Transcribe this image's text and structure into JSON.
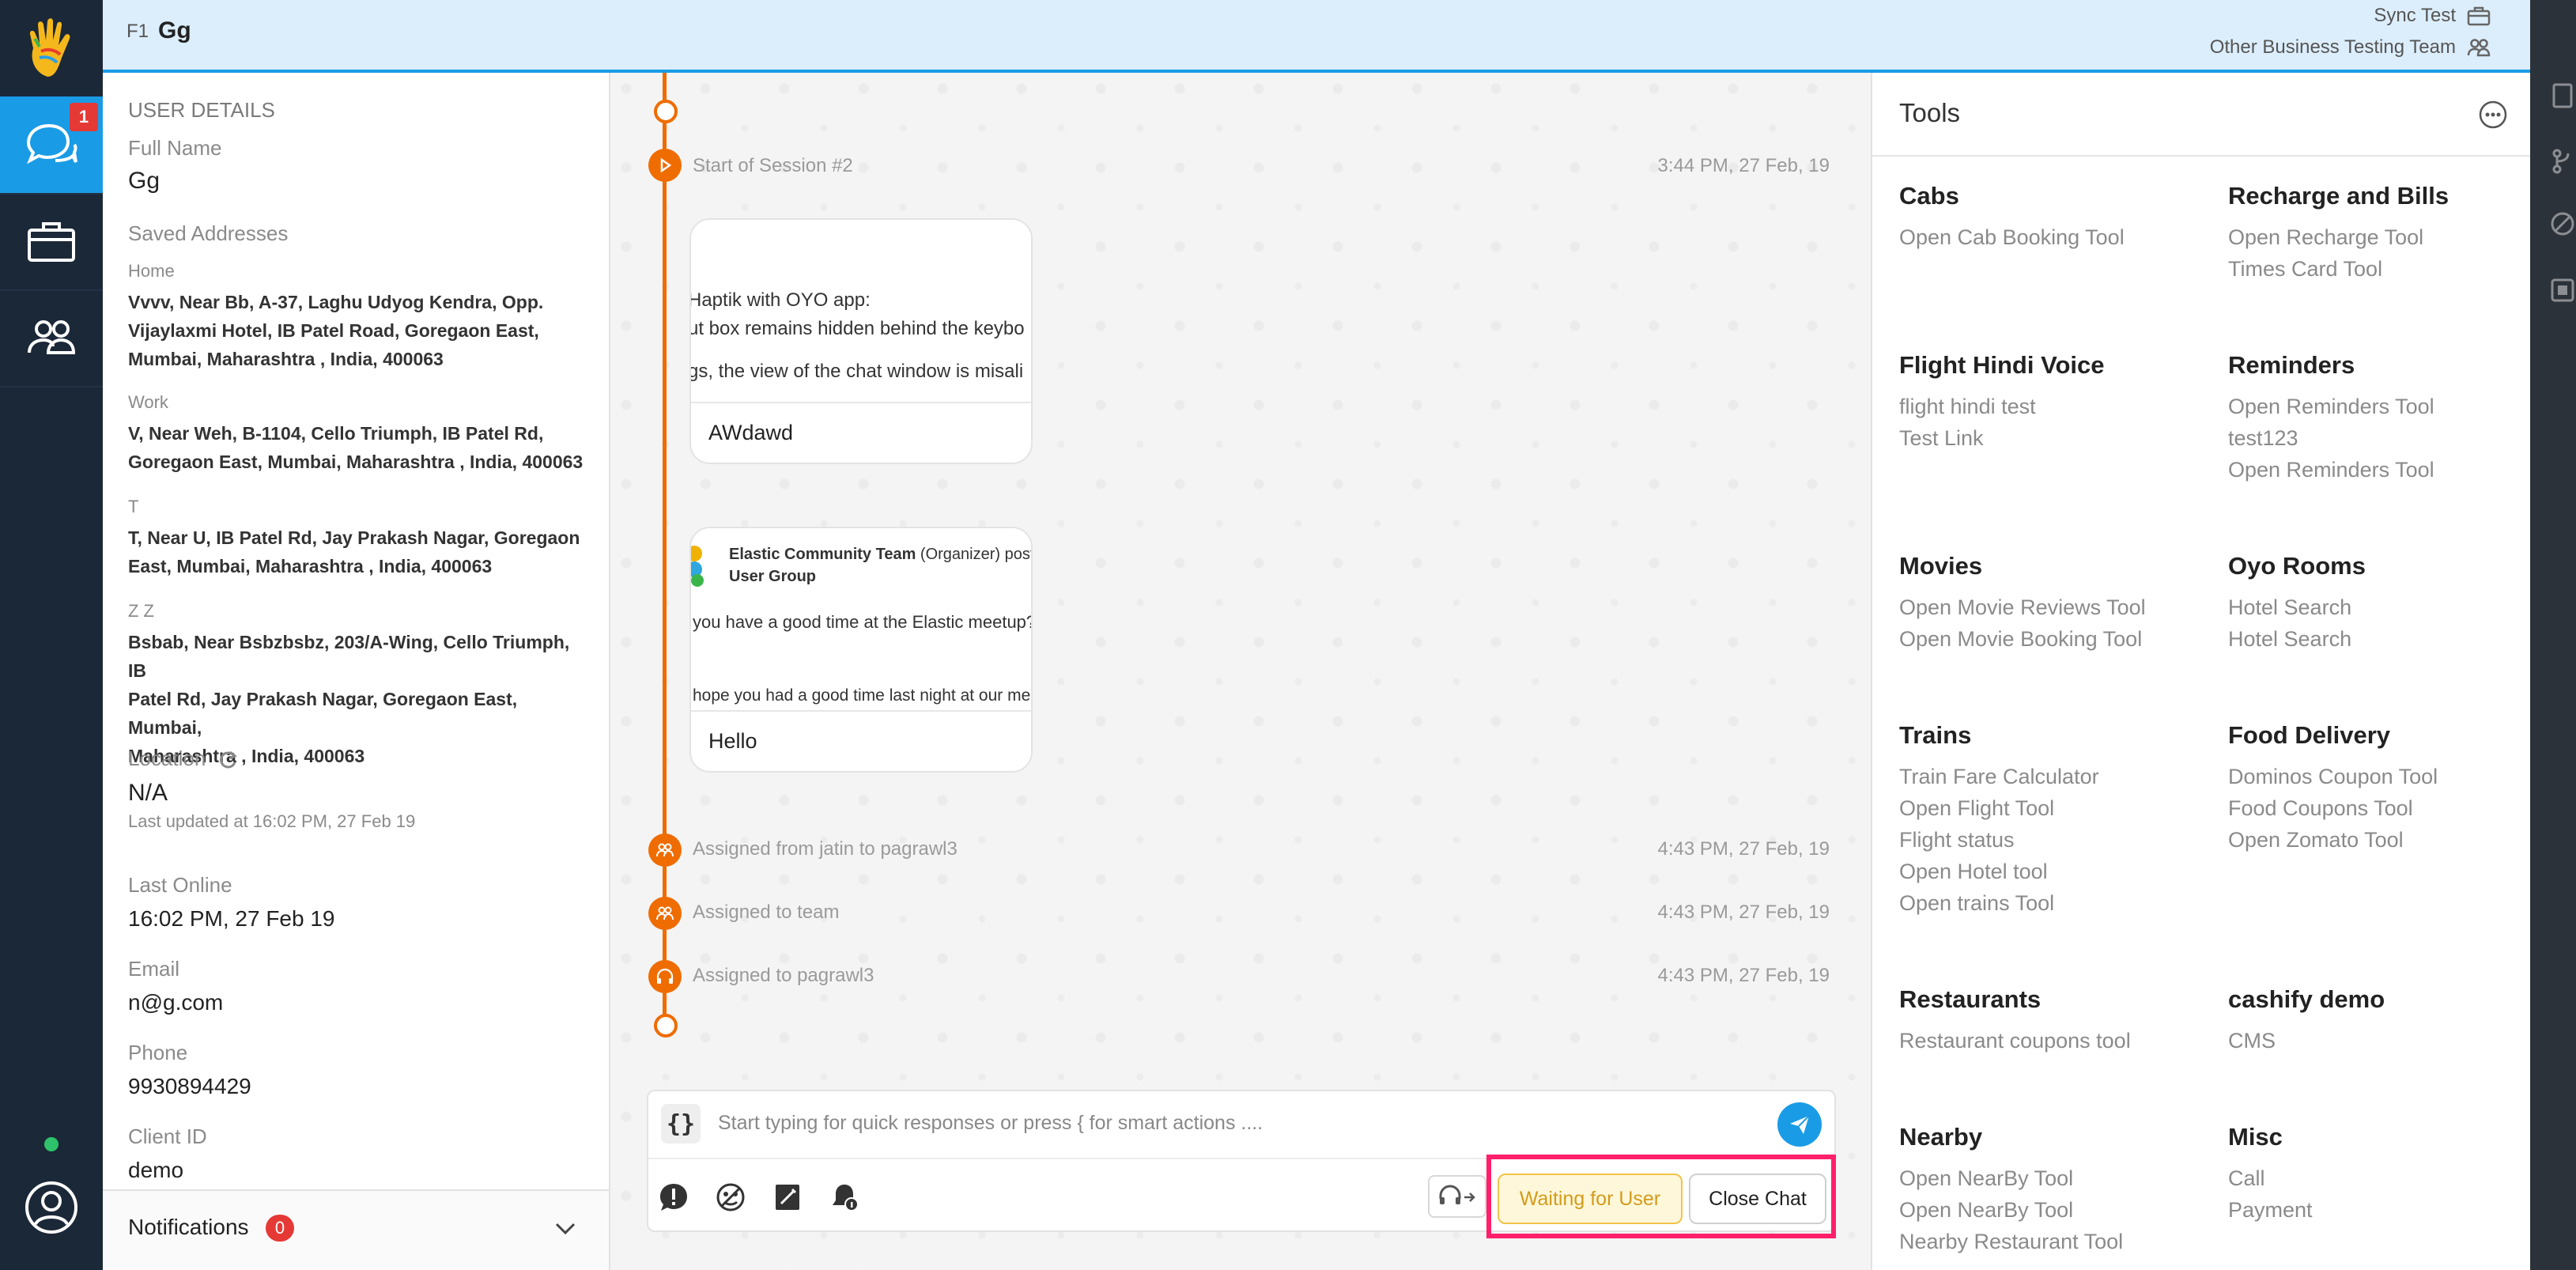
{
  "rail": {
    "chat_badge": "1"
  },
  "header": {
    "prefix": "F1",
    "user_name": "Gg",
    "business": "Sync Test",
    "team": "Other Business Testing Team"
  },
  "details": {
    "section_title": "USER DETAILS",
    "full_name_label": "Full Name",
    "full_name": "Gg",
    "saved_addresses_label": "Saved Addresses",
    "addresses": [
      {
        "label": "Home",
        "lines": [
          "Vvvv, Near Bb, A-37, Laghu Udyog Kendra, Opp.",
          "Vijaylaxmi Hotel, IB Patel Road, Goregaon East,",
          "Mumbai, Maharashtra , India, 400063"
        ]
      },
      {
        "label": "Work",
        "lines": [
          "V, Near Weh, B-1104, Cello Triumph, IB Patel Rd,",
          "Goregaon East, Mumbai, Maharashtra , India, 400063"
        ]
      },
      {
        "label": "T",
        "lines": [
          "T, Near U, IB Patel Rd, Jay Prakash Nagar, Goregaon",
          "East, Mumbai, Maharashtra , India, 400063"
        ]
      },
      {
        "label": "Z Z",
        "lines": [
          "Bsbab, Near Bsbzbsbz, 203/A-Wing, Cello Triumph, IB",
          "Patel Rd, Jay Prakash Nagar, Goregaon East, Mumbai,",
          "Maharashtra , India, 400063"
        ]
      }
    ],
    "location_label": "Location",
    "location": "N/A",
    "location_updated": "Last updated at 16:02 PM, 27 Feb 19",
    "last_online_label": "Last Online",
    "last_online": "16:02 PM, 27 Feb 19",
    "email_label": "Email",
    "email": "n@g.com",
    "phone_label": "Phone",
    "phone": "9930894429",
    "client_id_label": "Client ID",
    "client_id": "demo",
    "notifications_label": "Notifications",
    "notifications_count": "0"
  },
  "chat": {
    "session_start": "Start of Session #2",
    "session_time": "3:44 PM, 27 Feb, 19",
    "card1": {
      "snippet1": "Haptik with OYO app:",
      "snippet2": "ut box remains hidden behind the keybo",
      "snippet3": "gs, the view of the chat window is misali",
      "title": "AWdawd"
    },
    "card2": {
      "org": "Elastic Community Team",
      "org_role": "(Organizer) post",
      "group": "User Group",
      "snippet1": "you have a good time at the Elastic meetup?",
      "snippet2": "hope you had a good time last night at our meet",
      "title": "Hello"
    },
    "events": [
      {
        "text": "Assigned from jatin to pagrawl3",
        "time": "4:43 PM, 27 Feb, 19"
      },
      {
        "text": "Assigned to team",
        "time": "4:43 PM, 27 Feb, 19"
      },
      {
        "text": "Assigned to pagrawl3",
        "time": "4:43 PM, 27 Feb, 19"
      }
    ],
    "composer_braces": "{}",
    "composer_placeholder": "Start typing for quick responses or press { for smart actions ....",
    "waiting_label": "Waiting for User",
    "close_label": "Close Chat"
  },
  "tools": {
    "title": "Tools",
    "left": [
      {
        "heading": "Cabs",
        "items": [
          "Open Cab Booking Tool"
        ]
      },
      {
        "heading": "Flight Hindi Voice",
        "items": [
          "flight hindi test",
          "Test Link"
        ]
      },
      {
        "heading": "Movies",
        "items": [
          "Open Movie Reviews Tool",
          "Open Movie Booking Tool"
        ]
      },
      {
        "heading": "Trains",
        "items": [
          "Train Fare Calculator",
          "Open Flight Tool",
          "Flight status",
          "Open Hotel tool",
          "Open trains Tool"
        ]
      },
      {
        "heading": "Restaurants",
        "items": [
          "Restaurant coupons tool"
        ]
      },
      {
        "heading": "Nearby",
        "items": [
          "Open NearBy Tool",
          "Open NearBy Tool",
          "Nearby Restaurant Tool"
        ]
      }
    ],
    "right": [
      {
        "heading": "Recharge and Bills",
        "items": [
          "Open Recharge Tool",
          "Times Card Tool"
        ]
      },
      {
        "heading": "Reminders",
        "items": [
          "Open Reminders Tool",
          "test123",
          "Open Reminders Tool"
        ]
      },
      {
        "heading": "Oyo Rooms",
        "items": [
          "Hotel Search",
          "Hotel Search"
        ]
      },
      {
        "heading": "Food Delivery",
        "items": [
          "Dominos Coupon Tool",
          "Food Coupons Tool",
          "Open Zomato Tool"
        ]
      },
      {
        "heading": "cashify demo",
        "items": [
          "CMS"
        ]
      },
      {
        "heading": "Misc",
        "items": [
          "Call",
          "Payment"
        ]
      }
    ]
  },
  "colors": {
    "accent": "#1a9be6",
    "timeline": "#ef6c00",
    "highlight": "#ff1f6b",
    "rail": "#1b2838"
  }
}
